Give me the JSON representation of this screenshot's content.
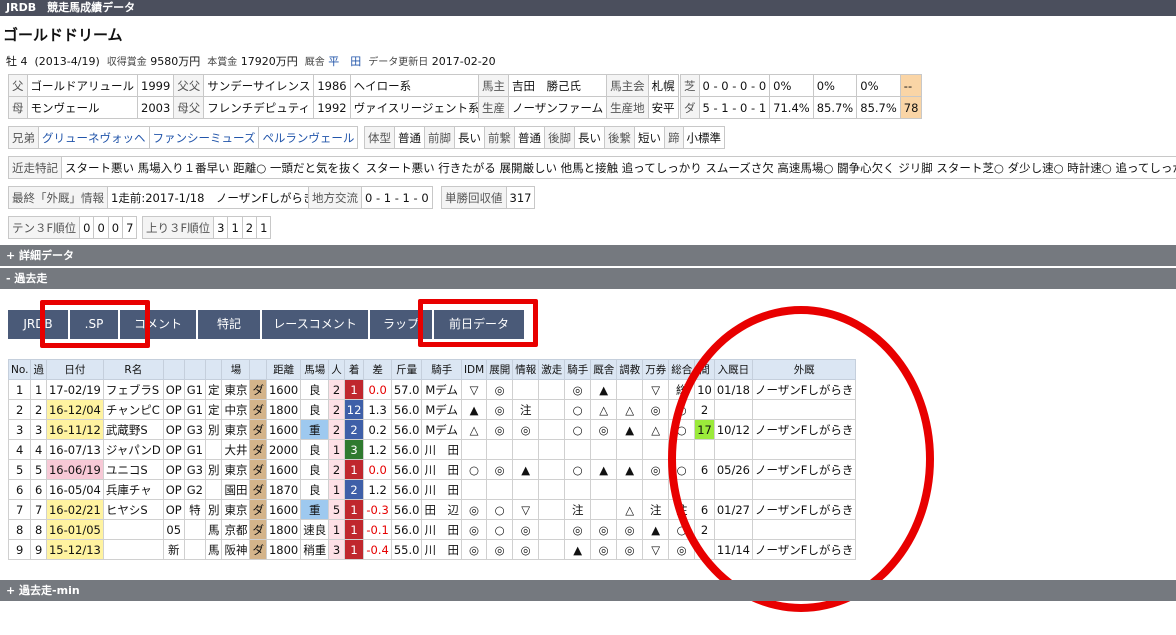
{
  "app_title": "JRDB　競走馬成績データ",
  "horse_name": "ゴールドドリーム",
  "meta": {
    "sex_age": "牡 4",
    "birth": "(2013-4/19)",
    "prize_label": "収得賞金",
    "prize": "9580万円",
    "main_prize_label": "本賞金",
    "main_prize": "17920万円",
    "stable_label": "厩舎",
    "trainer": "平　田",
    "update_label": "データ更新日",
    "update": "2017-02-20"
  },
  "pedigree": [
    [
      "父",
      "ゴールドアリュール",
      "1999",
      "父父",
      "サンデーサイレンス",
      "1986",
      "ヘイロー系"
    ],
    [
      "母",
      "モンヴェール",
      "2003",
      "母父",
      "フレンチデピュティ",
      "1992",
      "ヴァイスリージェント系"
    ]
  ],
  "owner": {
    "owner_label": "馬主",
    "owner": "吉田　勝己氏",
    "club_label": "馬主会",
    "club": "札幌",
    "breeder_label": "生産",
    "breeder": "ノーザンファーム",
    "origin_label": "生産地",
    "origin": "安平"
  },
  "surface": [
    [
      "芝",
      "0 - 0 - 0 - 0",
      "0%",
      "0%",
      "0%",
      "--"
    ],
    [
      "ダ",
      "5 - 1 - 0 - 1",
      "71.4%",
      "85.7%",
      "85.7%",
      "78"
    ]
  ],
  "siblings_label": "兄弟",
  "siblings": [
    "グリューネヴォッヘ",
    "ファンシーミューズ",
    "ペルランヴェール"
  ],
  "body": [
    "体型",
    "普通",
    "前脚",
    "長い",
    "前繋",
    "普通",
    "後脚",
    "長い",
    "後繋",
    "短い",
    "蹄",
    "小標準"
  ],
  "recent_label": "近走特記",
  "recent": "スタート悪い 馬場入り１番早い 距離○ 一頭だと気を抜く スタート悪い 行きたがる 展開厳しい 他馬と接触 追ってしっかり スムーズさ欠 高速馬場○ 闘争心欠く ジリ脚 スタート芝○ ダ少し速○ 時計速○ 追ってしっかり",
  "last_foreign_label": "最終「外厩」情報",
  "last_foreign": "1走前:2017-1/18　ノーザンFしがらき",
  "local_label": "地方交流",
  "local": "0 - 1 - 1 - 0",
  "win_return_label": "単勝回収値",
  "win_return": "317",
  "ten3f_label": "テン３F順位",
  "ten3f": [
    "0",
    "0",
    "0",
    "7"
  ],
  "agari3f_label": "上り３F順位",
  "agari3f": [
    "3",
    "1",
    "2",
    "1"
  ],
  "sections": {
    "detail": "+ 詳細データ",
    "past": "- 過去走",
    "pastmin": "+ 過去走-min"
  },
  "tabs": [
    "JRDB",
    ".SP",
    "コメント",
    "特記",
    "レースコメント",
    "ラップ",
    "前日データ"
  ],
  "table_headers": [
    "No.",
    "過",
    "日付",
    "R名",
    "",
    "",
    "",
    "場",
    "",
    "距離",
    "馬場",
    "人",
    "着",
    "差",
    "斤量",
    "騎手",
    "IDM",
    "展開",
    "情報",
    "激走",
    "騎手",
    "厩舎",
    "調教",
    "万券",
    "総合",
    "間",
    "入厩日",
    "外厩"
  ],
  "rows": [
    [
      "1",
      "1",
      "17-02/19",
      "フェブラS",
      "OP",
      "G1",
      "定",
      "東京",
      "ダ",
      "1600",
      "良",
      "2",
      "1",
      "0.0",
      "57.0",
      "Mデム",
      "▽",
      "◎",
      "",
      "",
      "◎",
      "▲",
      "",
      "▽",
      "総",
      "10",
      "01/18",
      "ノーザンFしがらき"
    ],
    [
      "2",
      "2",
      "16-12/04",
      "チャンピC",
      "OP",
      "G1",
      "定",
      "中京",
      "ダ",
      "1800",
      "良",
      "2",
      "12",
      "1.3",
      "56.0",
      "Mデム",
      "▲",
      "◎",
      "注",
      "",
      "○",
      "△",
      "△",
      "◎",
      "○",
      "2",
      "",
      ""
    ],
    [
      "3",
      "3",
      "16-11/12",
      "武蔵野S",
      "OP",
      "G3",
      "別",
      "東京",
      "ダ",
      "1600",
      "重",
      "2",
      "2",
      "0.2",
      "56.0",
      "Mデム",
      "△",
      "◎",
      "◎",
      "",
      "○",
      "◎",
      "▲",
      "△",
      "○",
      "17",
      "10/12",
      "ノーザンFしがらき"
    ],
    [
      "4",
      "4",
      "16-07/13",
      "ジャパンD",
      "OP",
      "G1",
      "",
      "大井",
      "ダ",
      "2000",
      "良",
      "1",
      "3",
      "1.2",
      "56.0",
      "川　田",
      "",
      "",
      "",
      "",
      "",
      "",
      "",
      "",
      "",
      "",
      "",
      ""
    ],
    [
      "5",
      "5",
      "16-06/19",
      "ユニコS",
      "OP",
      "G3",
      "別",
      "東京",
      "ダ",
      "1600",
      "良",
      "2",
      "1",
      "0.0",
      "56.0",
      "川　田",
      "○",
      "◎",
      "▲",
      "",
      "○",
      "▲",
      "▲",
      "◎",
      "○",
      "6",
      "05/26",
      "ノーザンFしがらき"
    ],
    [
      "6",
      "6",
      "16-05/04",
      "兵庫チャ",
      "OP",
      "G2",
      "",
      "園田",
      "ダ",
      "1870",
      "良",
      "1",
      "2",
      "1.2",
      "56.0",
      "川　田",
      "",
      "",
      "",
      "",
      "",
      "",
      "",
      "",
      "",
      "",
      "",
      ""
    ],
    [
      "7",
      "7",
      "16-02/21",
      "ヒヤシS",
      "OP",
      "特",
      "別",
      "東京",
      "ダ",
      "1600",
      "重",
      "5",
      "1",
      "-0.3",
      "56.0",
      "田　辺",
      "◎",
      "○",
      "▽",
      "",
      "注",
      "",
      "△",
      "注",
      "注",
      "6",
      "01/27",
      "ノーザンFしがらき"
    ],
    [
      "8",
      "8",
      "16-01/05",
      "",
      "05",
      "",
      "馬",
      "京都",
      "ダ",
      "1800",
      "速良",
      "1",
      "1",
      "-0.1",
      "56.0",
      "川　田",
      "◎",
      "○",
      "◎",
      "",
      "◎",
      "◎",
      "◎",
      "▲",
      "○",
      "2",
      "",
      ""
    ],
    [
      "9",
      "9",
      "15-12/13",
      "",
      "新",
      "",
      "馬",
      "阪神",
      "ダ",
      "1800",
      "稍重",
      "3",
      "1",
      "-0.4",
      "55.0",
      "川　田",
      "◎",
      "◎",
      "◎",
      "",
      "▲",
      "◎",
      "◎",
      "▽",
      "◎",
      "",
      "11/14",
      "ノーザンFしがらき"
    ]
  ]
}
